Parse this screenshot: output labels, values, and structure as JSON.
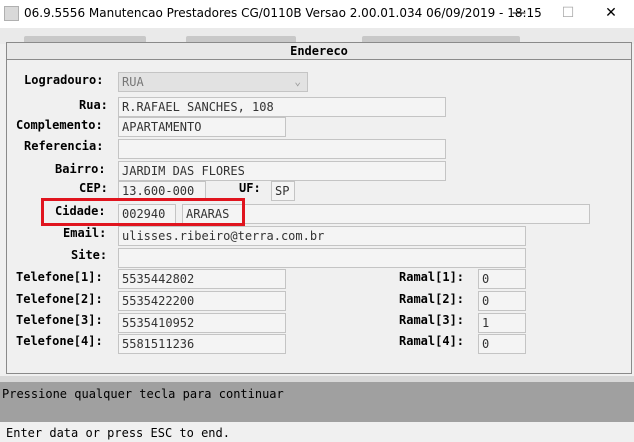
{
  "window": {
    "title": "06.9.5556 Manutencao  Prestadores CG/0110B Versao 2.00.01.034 06/09/2019 - 18:15",
    "minimize": "—",
    "maximize": "☐",
    "close": "✕"
  },
  "dialog": {
    "title": "Endereco"
  },
  "form": {
    "logradouro": {
      "label": "Logradouro:",
      "value": "RUA"
    },
    "rua": {
      "label": "Rua:",
      "value": "R.RAFAEL SANCHES, 108"
    },
    "complemento": {
      "label": "Complemento:",
      "value": "APARTAMENTO"
    },
    "referencia": {
      "label": "Referencia:",
      "value": ""
    },
    "bairro": {
      "label": "Bairro:",
      "value": "JARDIM DAS FLORES"
    },
    "cep": {
      "label": "CEP:",
      "value": "13.600-000"
    },
    "uf": {
      "label": "UF:",
      "value": "SP"
    },
    "cidade": {
      "label": "Cidade:",
      "code": "002940",
      "name": "ARARAS"
    },
    "email": {
      "label": "Email:",
      "value": "ulisses.ribeiro@terra.com.br"
    },
    "site": {
      "label": "Site:",
      "value": ""
    },
    "phones": [
      {
        "label": "Telefone[1]:",
        "value": "5535442802",
        "ramal_label": "Ramal[1]:",
        "ramal": "0"
      },
      {
        "label": "Telefone[2]:",
        "value": "5535422200",
        "ramal_label": "Ramal[2]:",
        "ramal": "0"
      },
      {
        "label": "Telefone[3]:",
        "value": "5535410952",
        "ramal_label": "Ramal[3]:",
        "ramal": "1"
      },
      {
        "label": "Telefone[4]:",
        "value": "5581511236",
        "ramal_label": "Ramal[4]:",
        "ramal": "0"
      }
    ]
  },
  "status": {
    "message": "Pressione qualquer tecla para continuar",
    "hint": "Enter data or press ESC to end."
  },
  "colors": {
    "highlight": "#e0141e",
    "status_bar": "#a0a0a0"
  }
}
